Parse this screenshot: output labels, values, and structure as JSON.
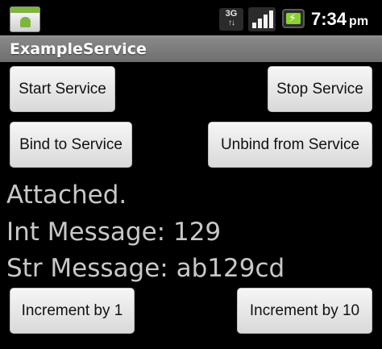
{
  "status_bar": {
    "network_type": "3G",
    "time": "7:34",
    "ampm": "pm"
  },
  "app": {
    "title": "ExampleService"
  },
  "buttons": {
    "start_service": "Start Service",
    "stop_service": "Stop Service",
    "bind_service": "Bind to Service",
    "unbind_service": "Unbind from Service",
    "increment_1": "Increment by 1",
    "increment_10": "Increment by 10"
  },
  "status": {
    "connection": "Attached.",
    "int_message": "Int Message: 129",
    "str_message": "Str Message: ab129cd"
  },
  "colors": {
    "background": "#000000",
    "title_bar": "#7b7b7b",
    "button": "#e6e6e6",
    "status_text": "#c8c8c8",
    "battery_charging": "#8ad134"
  }
}
